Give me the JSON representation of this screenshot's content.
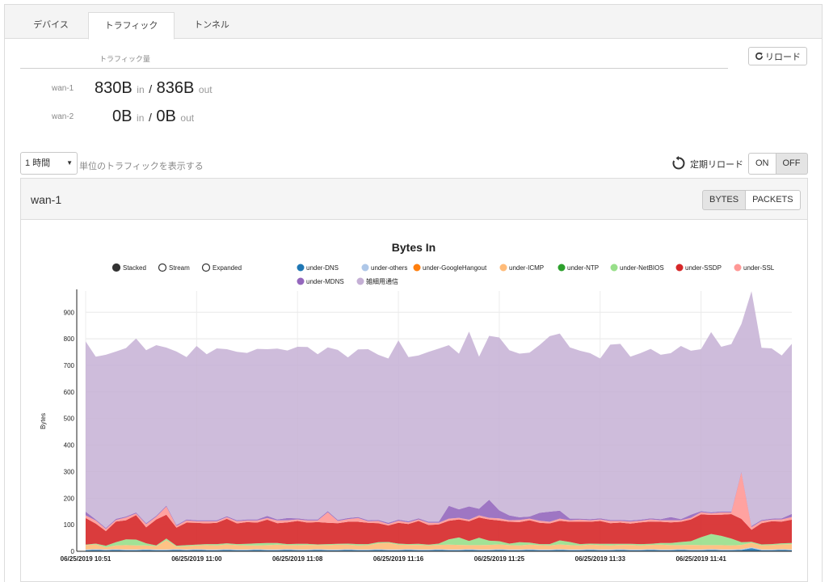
{
  "tabs": [
    {
      "label": "デバイス",
      "active": false
    },
    {
      "label": "トラフィック",
      "active": true
    },
    {
      "label": "トンネル",
      "active": false
    }
  ],
  "traffic_section_label": "トラフィック量",
  "reload_button": "リロード",
  "wan_stats": [
    {
      "name": "wan-1",
      "in": "830B",
      "in_unit": "in",
      "sep": "/",
      "out": "836B",
      "out_unit": "out"
    },
    {
      "name": "wan-2",
      "in": "0B",
      "in_unit": "in",
      "sep": "/",
      "out": "0B",
      "out_unit": "out"
    }
  ],
  "range_select": {
    "value": "1 時間",
    "caret": "▼"
  },
  "range_note": "単位のトラフィックを表示する",
  "auto_refresh": {
    "label": "定期リロード",
    "on": "ON",
    "off": "OFF",
    "selected": "OFF"
  },
  "panel": {
    "title": "wan-1",
    "bytes": "BYTES",
    "packets": "PACKETS",
    "selected": "BYTES"
  },
  "chart_modes": [
    "Stacked",
    "Stream",
    "Expanded"
  ],
  "chart_data": {
    "type": "area",
    "title": "Bytes In",
    "ylabel": "Bytes",
    "xlabel": "",
    "ylim": [
      0,
      980
    ],
    "yticks": [
      0,
      100,
      200,
      300,
      400,
      500,
      600,
      700,
      800,
      900
    ],
    "x_tick_labels": [
      {
        "i": 0,
        "label": "06/25/2019 10:51"
      },
      {
        "i": 11,
        "label": "06/25/2019 11:00"
      },
      {
        "i": 21,
        "label": "06/25/2019 11:08"
      },
      {
        "i": 31,
        "label": "06/25/2019 11:16"
      },
      {
        "i": 41,
        "label": "06/25/2019 11:25"
      },
      {
        "i": 51,
        "label": "06/25/2019 11:33"
      },
      {
        "i": 61,
        "label": "06/25/2019 11:41"
      }
    ],
    "grid": true,
    "legend_position": "top",
    "series": [
      {
        "name": "under-DNS",
        "color": "#1f77b4",
        "values": [
          4,
          5,
          4,
          5,
          4,
          4,
          5,
          4,
          4,
          5,
          4,
          5,
          4,
          4,
          5,
          4,
          4,
          5,
          4,
          4,
          5,
          4,
          4,
          5,
          4,
          4,
          5,
          4,
          4,
          5,
          4,
          4,
          5,
          4,
          4,
          5,
          4,
          4,
          5,
          4,
          4,
          5,
          4,
          4,
          5,
          4,
          4,
          5,
          4,
          4,
          5,
          4,
          4,
          5,
          4,
          4,
          5,
          4,
          4,
          5,
          4,
          4,
          5,
          4,
          4,
          5,
          12,
          4,
          4,
          5,
          4
        ]
      },
      {
        "name": "under-others",
        "color": "#aec7e8",
        "values": [
          3,
          3,
          3,
          3,
          3,
          3,
          3,
          3,
          3,
          3,
          3,
          3,
          3,
          3,
          3,
          3,
          3,
          3,
          3,
          3,
          3,
          3,
          3,
          3,
          3,
          3,
          3,
          3,
          3,
          3,
          3,
          3,
          3,
          3,
          3,
          3,
          3,
          3,
          3,
          3,
          3,
          3,
          3,
          3,
          3,
          3,
          3,
          3,
          3,
          3,
          3,
          3,
          3,
          3,
          3,
          3,
          3,
          3,
          3,
          3,
          3,
          3,
          3,
          3,
          3,
          3,
          3,
          3,
          3,
          3,
          3
        ]
      },
      {
        "name": "under-GoogleHangout",
        "color": "#ff7f0e",
        "values": [
          0,
          0,
          0,
          0,
          0,
          0,
          0,
          0,
          0,
          0,
          0,
          0,
          0,
          0,
          0,
          0,
          0,
          0,
          0,
          0,
          0,
          0,
          0,
          0,
          0,
          0,
          0,
          0,
          0,
          0,
          0,
          0,
          0,
          0,
          0,
          0,
          0,
          0,
          0,
          0,
          0,
          0,
          0,
          0,
          0,
          0,
          0,
          0,
          0,
          0,
          0,
          0,
          0,
          0,
          0,
          0,
          0,
          0,
          0,
          0,
          0,
          0,
          0,
          0,
          0,
          0,
          0,
          0,
          0,
          0,
          0
        ]
      },
      {
        "name": "under-ICMP",
        "color": "#ffbb78",
        "values": [
          16,
          18,
          8,
          14,
          16,
          15,
          14,
          12,
          35,
          10,
          12,
          14,
          16,
          15,
          18,
          16,
          15,
          14,
          16,
          18,
          15,
          16,
          17,
          15,
          16,
          18,
          17,
          15,
          16,
          22,
          25,
          18,
          16,
          17,
          15,
          16,
          18,
          17,
          15,
          16,
          17,
          18,
          16,
          15,
          17,
          16,
          15,
          18,
          16,
          15,
          17,
          16,
          15,
          16,
          17,
          15,
          16,
          18,
          16,
          15,
          17,
          16,
          15,
          16,
          15,
          16,
          17,
          15,
          16,
          18,
          20
        ]
      },
      {
        "name": "under-NTP",
        "color": "#2ca02c",
        "values": [
          0,
          0,
          0,
          0,
          0,
          0,
          0,
          0,
          0,
          0,
          0,
          0,
          0,
          0,
          0,
          0,
          0,
          0,
          0,
          0,
          0,
          0,
          0,
          0,
          0,
          0,
          0,
          0,
          0,
          0,
          0,
          0,
          0,
          0,
          0,
          0,
          0,
          0,
          0,
          0,
          0,
          0,
          0,
          0,
          0,
          0,
          0,
          0,
          0,
          0,
          0,
          0,
          0,
          0,
          0,
          0,
          0,
          0,
          0,
          0,
          0,
          0,
          0,
          0,
          0,
          0,
          0,
          0,
          0,
          0,
          0
        ]
      },
      {
        "name": "under-NetBIOS",
        "color": "#98df8a",
        "values": [
          2,
          3,
          6,
          12,
          22,
          22,
          8,
          3,
          6,
          3,
          4,
          3,
          4,
          5,
          4,
          4,
          6,
          8,
          8,
          6,
          4,
          5,
          4,
          3,
          4,
          3,
          4,
          5,
          4,
          4,
          3,
          4,
          3,
          4,
          3,
          5,
          20,
          28,
          16,
          28,
          16,
          12,
          6,
          12,
          8,
          4,
          5,
          15,
          12,
          5,
          4,
          5,
          6,
          4,
          4,
          5,
          4,
          6,
          8,
          12,
          14,
          30,
          42,
          35,
          26,
          10,
          4,
          4,
          4,
          4,
          4
        ]
      },
      {
        "name": "under-SSDP",
        "color": "#d62728",
        "values": [
          100,
          75,
          55,
          78,
          72,
          92,
          60,
          98,
          90,
          68,
          85,
          82,
          78,
          80,
          92,
          78,
          82,
          78,
          88,
          75,
          82,
          86,
          80,
          84,
          80,
          78,
          82,
          84,
          80,
          72,
          62,
          78,
          76,
          86,
          74,
          72,
          70,
          68,
          74,
          76,
          80,
          78,
          82,
          76,
          84,
          80,
          78,
          74,
          76,
          84,
          82,
          86,
          78,
          80,
          76,
          82,
          84,
          80,
          78,
          76,
          82,
          86,
          72,
          80,
          92,
          88,
          45,
          80,
          86,
          82,
          88
        ]
      },
      {
        "name": "under-SSL",
        "color": "#ff9896",
        "values": [
          10,
          12,
          8,
          6,
          10,
          6,
          12,
          10,
          30,
          6,
          8,
          6,
          8,
          6,
          6,
          8,
          6,
          8,
          6,
          10,
          8,
          6,
          8,
          6,
          40,
          8,
          10,
          14,
          6,
          8,
          6,
          8,
          6,
          6,
          8,
          6,
          8,
          6,
          6,
          8,
          6,
          8,
          6,
          8,
          6,
          8,
          6,
          8,
          6,
          8,
          6,
          6,
          8,
          6,
          8,
          6,
          8,
          6,
          8,
          6,
          6,
          8,
          6,
          8,
          6,
          175,
          10,
          8,
          6,
          8,
          10
        ]
      },
      {
        "name": "under-MDNS",
        "color": "#9467bd",
        "values": [
          14,
          4,
          4,
          4,
          4,
          4,
          4,
          4,
          4,
          4,
          4,
          4,
          4,
          4,
          4,
          4,
          4,
          4,
          8,
          4,
          8,
          4,
          4,
          4,
          4,
          4,
          4,
          4,
          4,
          4,
          4,
          4,
          4,
          4,
          4,
          4,
          48,
          32,
          50,
          25,
          68,
          30,
          18,
          10,
          8,
          30,
          38,
          30,
          6,
          4,
          4,
          4,
          4,
          4,
          4,
          4,
          4,
          4,
          12,
          4,
          12,
          4,
          4,
          4,
          4,
          4,
          4,
          4,
          4,
          4,
          12
        ]
      },
      {
        "name": "雑細用通信",
        "color": "#c5b0d5",
        "values": [
          641,
          613,
          652,
          630,
          634,
          655,
          651,
          642,
          595,
          653,
          611,
          656,
          625,
          647,
          629,
          634,
          627,
          642,
          628,
          643,
          631,
          646,
          649,
          622,
          617,
          640,
          605,
          631,
          644,
          622,
          619,
          675,
          618,
          613,
          640,
          652,
          605,
          586,
          658,
          573,
          617,
          651,
          622,
          616,
          617,
          632,
          661,
          667,
          645,
          632,
          625,
          602,
          660,
          663,
          617,
          627,
          638,
          619,
          617,
          652,
          617,
          610,
          678,
          620,
          630,
          555,
          884,
          648,
          641,
          613,
          640
        ]
      }
    ]
  }
}
